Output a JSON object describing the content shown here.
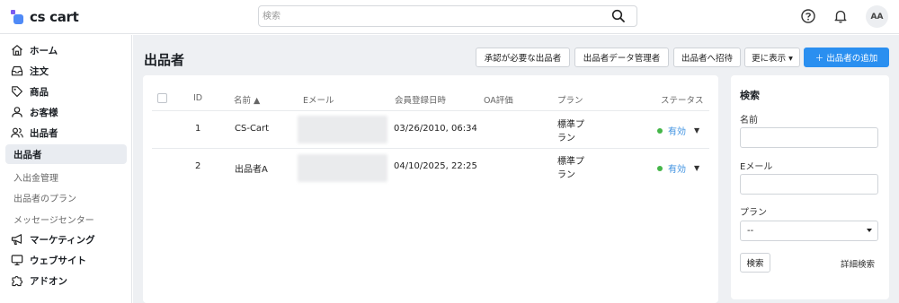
{
  "brand": {
    "name": "cs cart",
    "mark_primary": "#4f8af7",
    "mark_secondary": "#7b5cf0"
  },
  "header": {
    "search_placeholder": "検索",
    "search_icon": "search-icon",
    "help_icon": "help-circle-icon",
    "bell_icon": "bell-icon",
    "avatar_initials": "AA"
  },
  "sidebar": {
    "items": [
      {
        "label": "ホーム",
        "icon": "home-icon"
      },
      {
        "label": "注文",
        "icon": "inbox-icon"
      },
      {
        "label": "商品",
        "icon": "tag-icon"
      },
      {
        "label": "お客様",
        "icon": "user-icon"
      },
      {
        "label": "出品者",
        "icon": "users-icon"
      }
    ],
    "active_label": "出品者",
    "sub_items": [
      "入出金管理",
      "出品者のプラン",
      "メッセージセンター"
    ],
    "items_after": [
      {
        "label": "マーケティング",
        "icon": "megaphone-icon"
      },
      {
        "label": "ウェブサイト",
        "icon": "monitor-icon"
      },
      {
        "label": "アドオン",
        "icon": "puzzle-icon"
      }
    ]
  },
  "page": {
    "title": "出品者",
    "buttons": {
      "approval": "承認が必要な出品者",
      "data_admins": "出品者データ管理者",
      "invite": "出品者へ招待",
      "more": "更に表示 ▾",
      "add": "＋  出品者の追加"
    }
  },
  "table": {
    "headers": {
      "id": "ID",
      "name": "名前 ▲",
      "email": "Eメール",
      "registered": "会員登録日時",
      "oa": "OA評価",
      "plan": "プラン",
      "status": "ステータス"
    },
    "rows": [
      {
        "id": "1",
        "name": "CS-Cart",
        "registered": "03/26/2010, 06:34",
        "plan_line1": "標準プ",
        "plan_line2": "ラン",
        "status": "有効"
      },
      {
        "id": "2",
        "name": "出品者A",
        "registered": "04/10/2025, 22:25",
        "plan_line1": "標準プ",
        "plan_line2": "ラン",
        "status": "有効"
      }
    ],
    "status_color": "#45b649"
  },
  "filter": {
    "title": "検索",
    "name_label": "名前",
    "email_label": "Eメール",
    "plan_label": "プラン",
    "plan_value": "--",
    "search_button": "検索",
    "advanced_link": "詳細検索"
  },
  "accent": "#2a8ff0"
}
